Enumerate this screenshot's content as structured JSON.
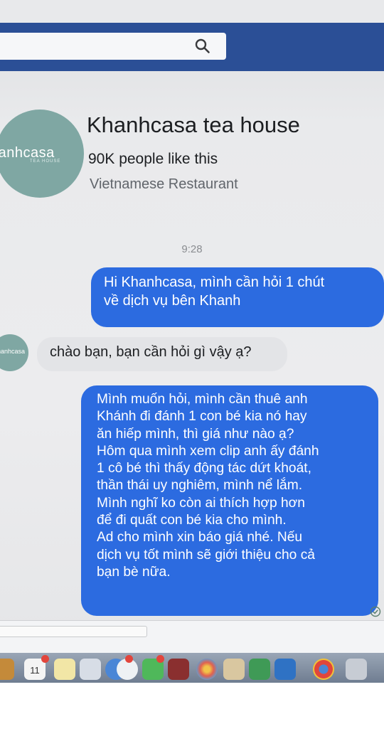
{
  "page": {
    "name": "Khanhcasa tea house",
    "likes": "90K people like this",
    "category": "Vietnamese Restaurant",
    "logo_text": "hanhcasa",
    "logo_sub": "TEA HOUSE",
    "avatar_small_text": "hanhcasa"
  },
  "chat": {
    "timestamp": "9:28",
    "messages": [
      {
        "from": "user",
        "lines": [
          "Hi Khanhcasa, mình cần hỏi 1 chút",
          "về dịch vụ bên Khanh"
        ]
      },
      {
        "from": "page",
        "lines": [
          "chào bạn, bạn cần hỏi gì vậy ạ?"
        ]
      },
      {
        "from": "user",
        "lines": [
          "Mình muốn hỏi, mình cần thuê anh",
          "Khánh đi đánh 1 con bé kia nó hay",
          "ăn hiếp mình, thì giá như nào ạ?",
          "Hôm qua mình xem clip anh ấy đánh",
          "1 cô bé thì thấy động tác dứt khoát,",
          "thần thái uy nghiêm, mình nể lắm.",
          "Mình nghĩ ko còn ai thích hợp hơn",
          "để đi quất con bé kia cho mình.",
          "Ad cho mình xin báo giá nhé. Nếu",
          "dịch vụ tốt mình sẽ giới thiệu cho cả",
          "bạn bè nữa."
        ]
      }
    ]
  },
  "dock": {
    "calendar_day": "11"
  },
  "colors": {
    "navbar": "#2b4f96",
    "outgoing_bubble": "#2c6be0",
    "incoming_bubble": "#e3e4e7",
    "avatar": "#7fa7a3"
  },
  "icons": [
    "search-icon",
    "seen-check-icon"
  ]
}
